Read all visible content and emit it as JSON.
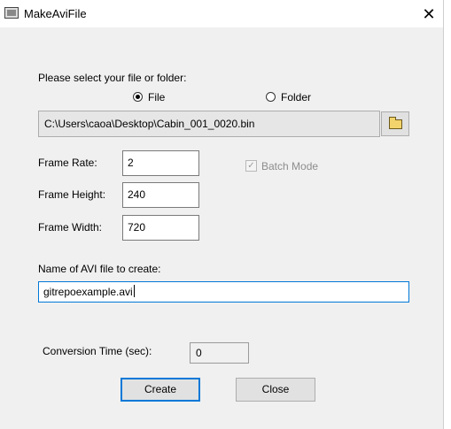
{
  "window": {
    "title": "MakeAviFile",
    "close_glyph": "✕",
    "icon": "film-icon"
  },
  "source": {
    "prompt": "Please select your file or folder:",
    "options": [
      {
        "label": "File",
        "selected": true
      },
      {
        "label": "Folder",
        "selected": false
      }
    ],
    "path": "C:\\Users\\caoa\\Desktop\\Cabin_001_0020.bin",
    "browse_icon": "folder-open-icon"
  },
  "settings": {
    "frame_rate_label": "Frame Rate:",
    "frame_rate": "2",
    "frame_height_label": "Frame Height:",
    "frame_height": "240",
    "frame_width_label": "Frame Width:",
    "frame_width": "720",
    "batch_mode_label": "Batch Mode",
    "batch_mode_checked": true,
    "batch_mode_enabled": false
  },
  "output": {
    "label": "Name of AVI file to create:",
    "filename": "gitrepoexample.avi"
  },
  "conversion": {
    "label": "Conversion Time (sec):",
    "value": "0"
  },
  "buttons": {
    "create": "Create",
    "close": "Close"
  },
  "colors": {
    "dialog_bg": "#f0f0f0",
    "focus_border": "#0078d7"
  }
}
